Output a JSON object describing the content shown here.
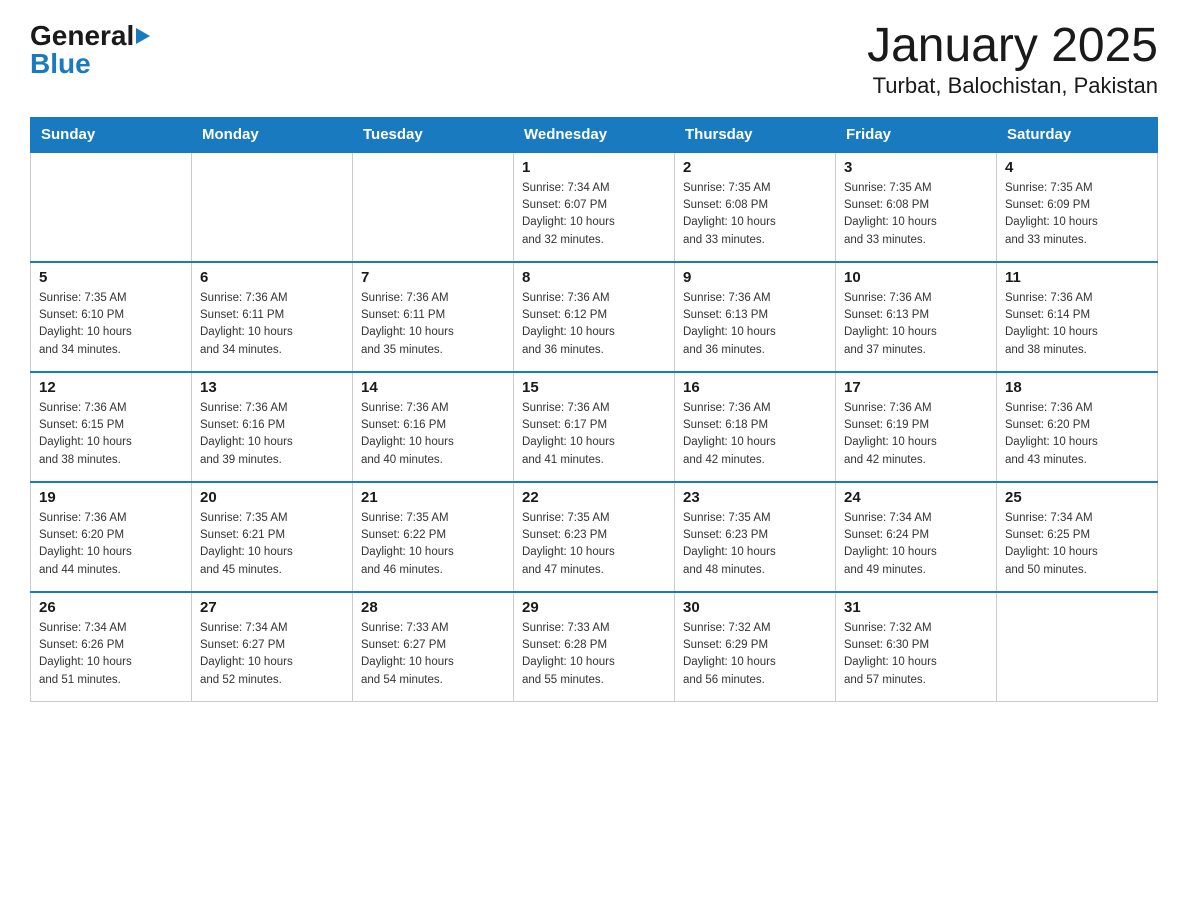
{
  "header": {
    "logo_general": "General",
    "logo_blue": "Blue",
    "month_title": "January 2025",
    "location": "Turbat, Balochistan, Pakistan"
  },
  "days_of_week": [
    "Sunday",
    "Monday",
    "Tuesday",
    "Wednesday",
    "Thursday",
    "Friday",
    "Saturday"
  ],
  "weeks": [
    [
      {
        "day": "",
        "info": ""
      },
      {
        "day": "",
        "info": ""
      },
      {
        "day": "",
        "info": ""
      },
      {
        "day": "1",
        "info": "Sunrise: 7:34 AM\nSunset: 6:07 PM\nDaylight: 10 hours\nand 32 minutes."
      },
      {
        "day": "2",
        "info": "Sunrise: 7:35 AM\nSunset: 6:08 PM\nDaylight: 10 hours\nand 33 minutes."
      },
      {
        "day": "3",
        "info": "Sunrise: 7:35 AM\nSunset: 6:08 PM\nDaylight: 10 hours\nand 33 minutes."
      },
      {
        "day": "4",
        "info": "Sunrise: 7:35 AM\nSunset: 6:09 PM\nDaylight: 10 hours\nand 33 minutes."
      }
    ],
    [
      {
        "day": "5",
        "info": "Sunrise: 7:35 AM\nSunset: 6:10 PM\nDaylight: 10 hours\nand 34 minutes."
      },
      {
        "day": "6",
        "info": "Sunrise: 7:36 AM\nSunset: 6:11 PM\nDaylight: 10 hours\nand 34 minutes."
      },
      {
        "day": "7",
        "info": "Sunrise: 7:36 AM\nSunset: 6:11 PM\nDaylight: 10 hours\nand 35 minutes."
      },
      {
        "day": "8",
        "info": "Sunrise: 7:36 AM\nSunset: 6:12 PM\nDaylight: 10 hours\nand 36 minutes."
      },
      {
        "day": "9",
        "info": "Sunrise: 7:36 AM\nSunset: 6:13 PM\nDaylight: 10 hours\nand 36 minutes."
      },
      {
        "day": "10",
        "info": "Sunrise: 7:36 AM\nSunset: 6:13 PM\nDaylight: 10 hours\nand 37 minutes."
      },
      {
        "day": "11",
        "info": "Sunrise: 7:36 AM\nSunset: 6:14 PM\nDaylight: 10 hours\nand 38 minutes."
      }
    ],
    [
      {
        "day": "12",
        "info": "Sunrise: 7:36 AM\nSunset: 6:15 PM\nDaylight: 10 hours\nand 38 minutes."
      },
      {
        "day": "13",
        "info": "Sunrise: 7:36 AM\nSunset: 6:16 PM\nDaylight: 10 hours\nand 39 minutes."
      },
      {
        "day": "14",
        "info": "Sunrise: 7:36 AM\nSunset: 6:16 PM\nDaylight: 10 hours\nand 40 minutes."
      },
      {
        "day": "15",
        "info": "Sunrise: 7:36 AM\nSunset: 6:17 PM\nDaylight: 10 hours\nand 41 minutes."
      },
      {
        "day": "16",
        "info": "Sunrise: 7:36 AM\nSunset: 6:18 PM\nDaylight: 10 hours\nand 42 minutes."
      },
      {
        "day": "17",
        "info": "Sunrise: 7:36 AM\nSunset: 6:19 PM\nDaylight: 10 hours\nand 42 minutes."
      },
      {
        "day": "18",
        "info": "Sunrise: 7:36 AM\nSunset: 6:20 PM\nDaylight: 10 hours\nand 43 minutes."
      }
    ],
    [
      {
        "day": "19",
        "info": "Sunrise: 7:36 AM\nSunset: 6:20 PM\nDaylight: 10 hours\nand 44 minutes."
      },
      {
        "day": "20",
        "info": "Sunrise: 7:35 AM\nSunset: 6:21 PM\nDaylight: 10 hours\nand 45 minutes."
      },
      {
        "day": "21",
        "info": "Sunrise: 7:35 AM\nSunset: 6:22 PM\nDaylight: 10 hours\nand 46 minutes."
      },
      {
        "day": "22",
        "info": "Sunrise: 7:35 AM\nSunset: 6:23 PM\nDaylight: 10 hours\nand 47 minutes."
      },
      {
        "day": "23",
        "info": "Sunrise: 7:35 AM\nSunset: 6:23 PM\nDaylight: 10 hours\nand 48 minutes."
      },
      {
        "day": "24",
        "info": "Sunrise: 7:34 AM\nSunset: 6:24 PM\nDaylight: 10 hours\nand 49 minutes."
      },
      {
        "day": "25",
        "info": "Sunrise: 7:34 AM\nSunset: 6:25 PM\nDaylight: 10 hours\nand 50 minutes."
      }
    ],
    [
      {
        "day": "26",
        "info": "Sunrise: 7:34 AM\nSunset: 6:26 PM\nDaylight: 10 hours\nand 51 minutes."
      },
      {
        "day": "27",
        "info": "Sunrise: 7:34 AM\nSunset: 6:27 PM\nDaylight: 10 hours\nand 52 minutes."
      },
      {
        "day": "28",
        "info": "Sunrise: 7:33 AM\nSunset: 6:27 PM\nDaylight: 10 hours\nand 54 minutes."
      },
      {
        "day": "29",
        "info": "Sunrise: 7:33 AM\nSunset: 6:28 PM\nDaylight: 10 hours\nand 55 minutes."
      },
      {
        "day": "30",
        "info": "Sunrise: 7:32 AM\nSunset: 6:29 PM\nDaylight: 10 hours\nand 56 minutes."
      },
      {
        "day": "31",
        "info": "Sunrise: 7:32 AM\nSunset: 6:30 PM\nDaylight: 10 hours\nand 57 minutes."
      },
      {
        "day": "",
        "info": ""
      }
    ]
  ]
}
